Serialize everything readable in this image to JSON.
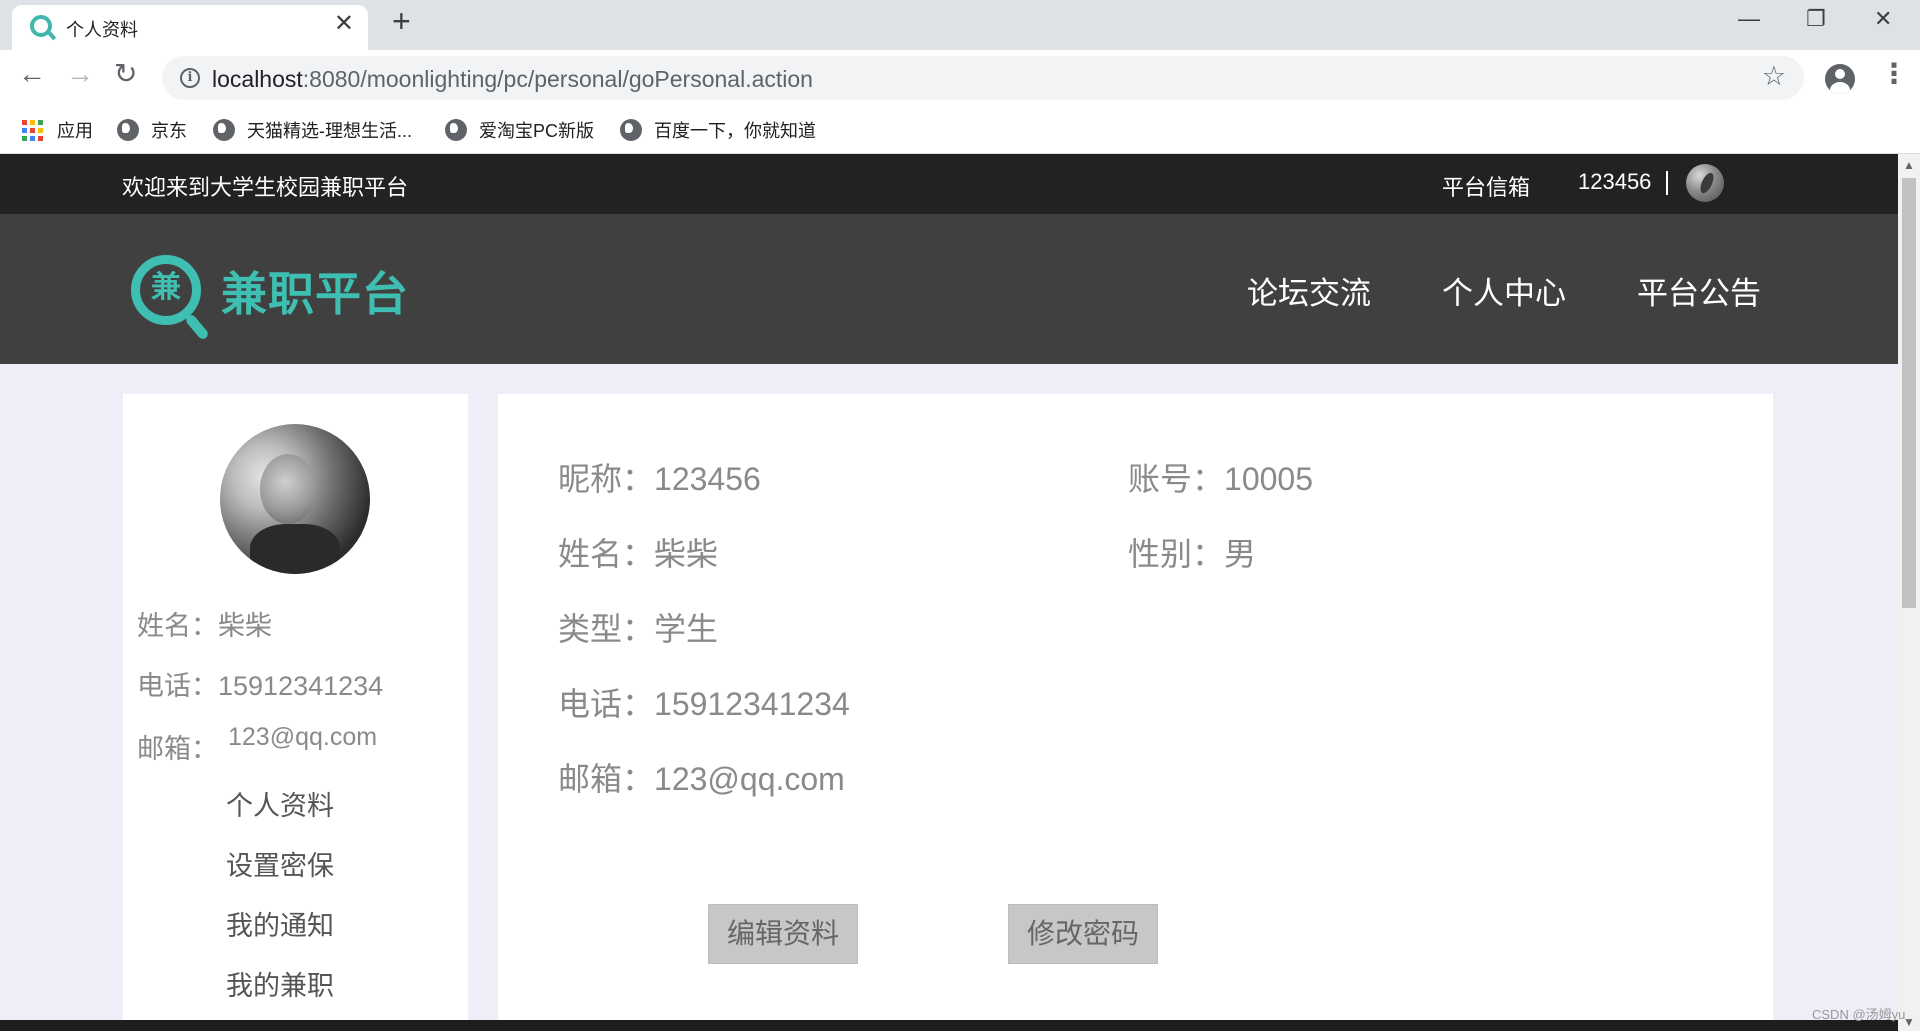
{
  "browser": {
    "tab_title": "个人资料",
    "tab_close": "✕",
    "new_tab": "+",
    "url_host": "localhost",
    "url_path": ":8080/moonlighting/pc/personal/goPersonal.action",
    "icons": [
      "back-icon",
      "forward-icon",
      "reload-icon",
      "info-icon",
      "star-icon",
      "profile-icon",
      "menu-icon",
      "minimize-icon",
      "restore-icon",
      "close-icon"
    ],
    "bookmarks": [
      {
        "label": "应用"
      },
      {
        "label": "京东"
      },
      {
        "label": "天猫精选-理想生活..."
      },
      {
        "label": "爱淘宝PC新版"
      },
      {
        "label": "百度一下，你就知道"
      }
    ]
  },
  "topbar": {
    "welcome": "欢迎来到大学生校园兼职平台",
    "mailbox": "平台信箱",
    "username": "123456"
  },
  "header": {
    "logo_char": "兼",
    "logo_text": "兼职平台",
    "nav": [
      "论坛交流",
      "个人中心",
      "平台公告"
    ],
    "accent_color": "#3fbfb2"
  },
  "sidebar": {
    "name_label": "姓名：",
    "name_value": "柴柴",
    "phone_label": "电话：",
    "phone_value": "15912341234",
    "email_label": "邮箱：",
    "email_value": "123@qq.com",
    "menu": [
      "个人资料",
      "设置密保",
      "我的通知",
      "我的兼职"
    ]
  },
  "profile": {
    "nickname_label": "昵称：",
    "nickname_value": "123456",
    "account_label": "账号：",
    "account_value": "10005",
    "name_label": "姓名：",
    "name_value": "柴柴",
    "gender_label": "性别：",
    "gender_value": "男",
    "type_label": "类型：",
    "type_value": "学生",
    "phone_label": "电话：",
    "phone_value": "15912341234",
    "email_label": "邮箱：",
    "email_value": "123@qq.com",
    "edit_button": "编辑资料",
    "password_button": "修改密码"
  },
  "watermark": "CSDN @汤姆yu"
}
